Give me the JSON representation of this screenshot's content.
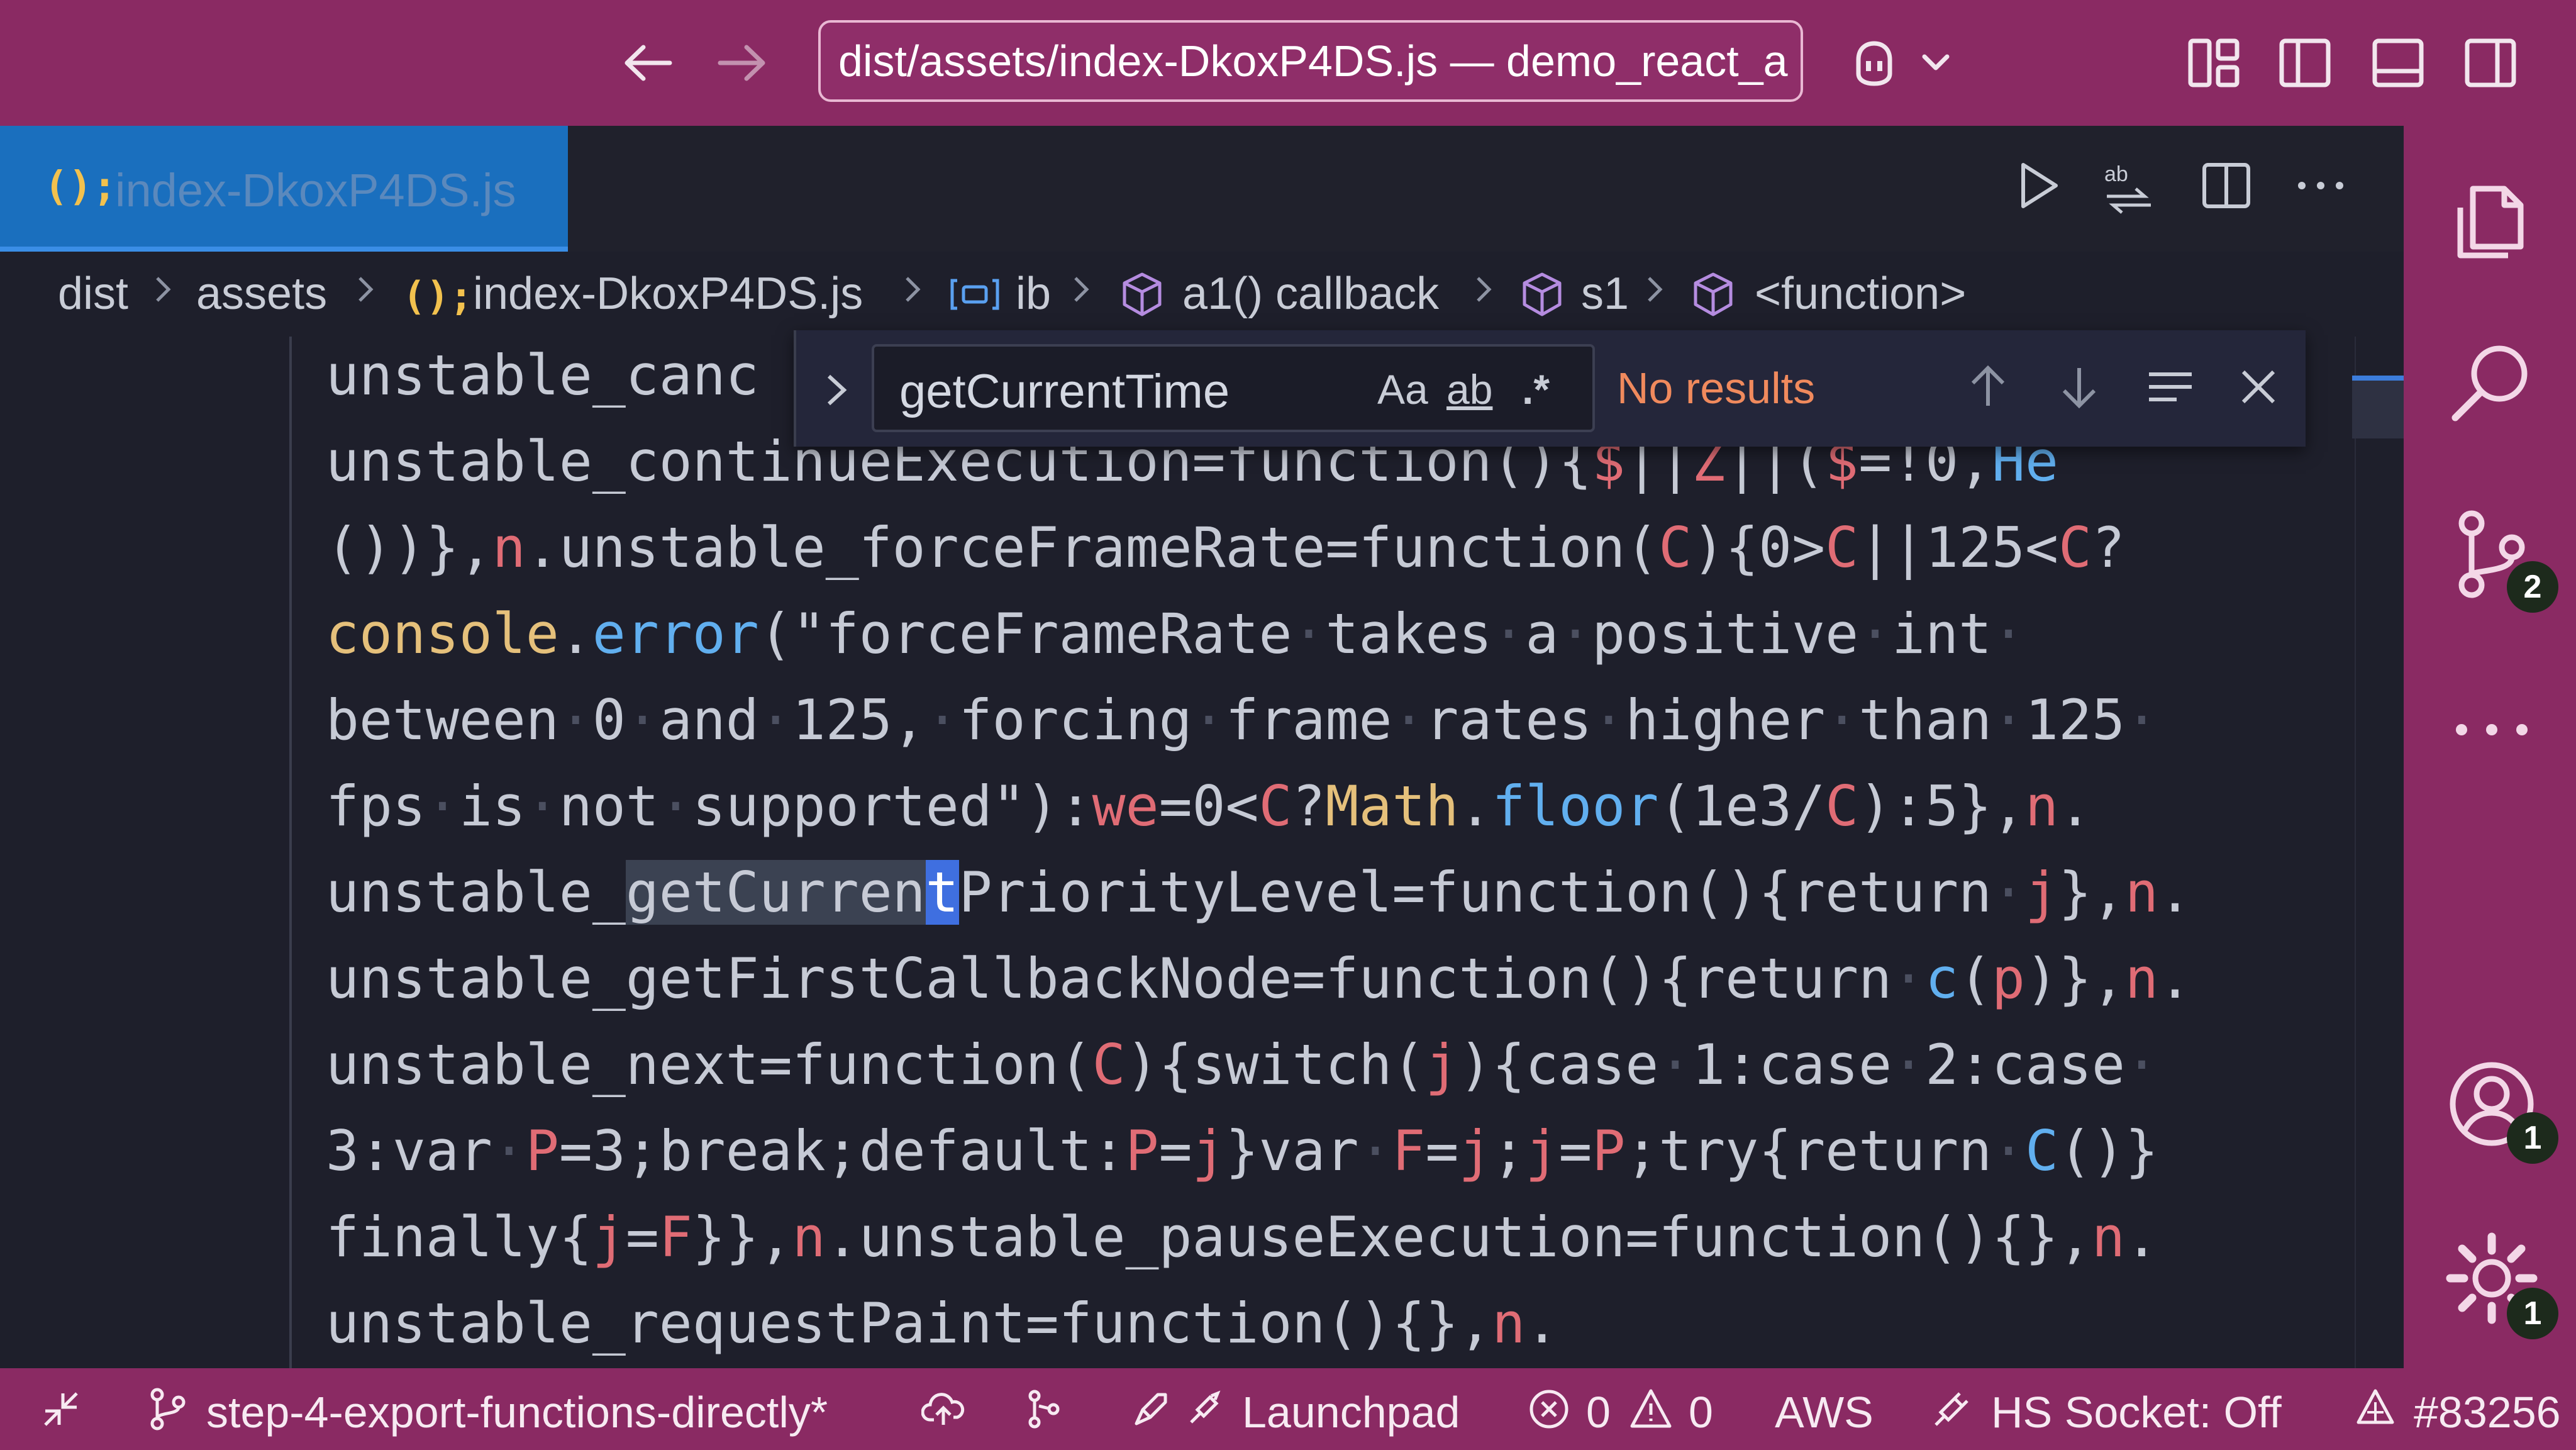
{
  "titlebar": {
    "command_center_text": "dist/assets/index-DkoxP4DS.js — demo_react_a",
    "icons": [
      "arrow-left-icon",
      "arrow-right-icon",
      "copilot-icon",
      "chevron-down-icon",
      "customize-layout-icon",
      "toggle-primary-sidebar-icon",
      "toggle-panel-icon",
      "toggle-secondary-sidebar-icon"
    ]
  },
  "tab": {
    "glyph": "(){}",
    "glyph_display": "();",
    "label": "index-DkoxP4DS.js"
  },
  "editor_actions": [
    "run-icon",
    "compare-icon",
    "split-editor-icon",
    "more-actions-icon"
  ],
  "breadcrumb": {
    "items": [
      "dist",
      "assets",
      "index-DkoxP4DS.js",
      "ib",
      "a1() callback",
      "s1",
      "<function>"
    ],
    "file_glyph": "();"
  },
  "find": {
    "query": "getCurrentTime",
    "match_case": "Aa",
    "whole_word": "ab",
    "regex": ".*",
    "status": "No results"
  },
  "code": {
    "lines": [
      "unstable_canc",
      "unstable_continueExecution=function(){$||Z||($=!0,He",
      "())},n.unstable_forceFrameRate=function(C){0>C||125<C?",
      "console.error(\"forceFrameRate takes a positive int",
      "between 0 and 125, forcing frame rates higher than 125",
      "fps is not supported\"):we=0<C?Math.floor(1e3/C):5},n.",
      "unstable_getCurrentPriorityLevel=function(){return j},n.",
      "unstable_getFirstCallbackNode=function(){return c(p)},n.",
      "unstable_next=function(C){switch(j){case 1:case 2:case",
      "3:var P=3;break;default:P=j}var F=j;j=P;try{return C()}",
      "finally{j=F}},n.unstable_pauseExecution=function(){},n.",
      "unstable_requestPaint=function(){},n."
    ]
  },
  "activity": {
    "icons": [
      "explorer-icon",
      "search-icon",
      "source-control-icon",
      "more-icon",
      "account-icon",
      "settings-gear-icon"
    ],
    "source_control_badge": "2",
    "account_badge": "1",
    "settings_badge": "1"
  },
  "status": {
    "branch": "step-4-export-functions-directly*",
    "launchpad": "Launchpad",
    "errors": "0",
    "warnings": "0",
    "aws": "AWS",
    "hs_socket": "HS Socket: Off",
    "pr": "#83256"
  },
  "colors": {
    "titlebar": "#8a2a63",
    "editor_bg": "#1e1f2b",
    "active_tab": "#1a6fbe",
    "find_status": "#f08a5d",
    "cursor": "#3f6fe0"
  }
}
